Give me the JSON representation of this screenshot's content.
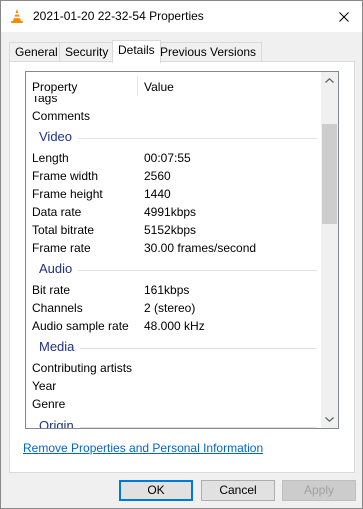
{
  "window": {
    "title": "2021-01-20 22-32-54 Properties"
  },
  "colors": {
    "group_header": "#1e3287",
    "link": "#0066cc",
    "accent": "#0078d7"
  },
  "tabs": [
    {
      "label": "General",
      "active": false
    },
    {
      "label": "Security",
      "active": false
    },
    {
      "label": "Details",
      "active": true
    },
    {
      "label": "Previous Versions",
      "active": false
    }
  ],
  "columns": {
    "property": "Property",
    "value": "Value"
  },
  "rows": {
    "tags": {
      "prop": "Tags",
      "val": ""
    },
    "comments": {
      "prop": "Comments",
      "val": ""
    },
    "video_group": "Video",
    "length": {
      "prop": "Length",
      "val": "00:07:55"
    },
    "frame_width": {
      "prop": "Frame width",
      "val": "2560"
    },
    "frame_height": {
      "prop": "Frame height",
      "val": "1440"
    },
    "data_rate": {
      "prop": "Data rate",
      "val": "4991kbps"
    },
    "total_bitrate": {
      "prop": "Total bitrate",
      "val": "5152kbps"
    },
    "frame_rate": {
      "prop": "Frame rate",
      "val": "30.00 frames/second"
    },
    "audio_group": "Audio",
    "bit_rate": {
      "prop": "Bit rate",
      "val": "161kbps"
    },
    "channels": {
      "prop": "Channels",
      "val": "2 (stereo)"
    },
    "audio_sample_rate": {
      "prop": "Audio sample rate",
      "val": "48.000 kHz"
    },
    "media_group": "Media",
    "contributing_artists": {
      "prop": "Contributing artists",
      "val": ""
    },
    "year": {
      "prop": "Year",
      "val": ""
    },
    "genre": {
      "prop": "Genre",
      "val": ""
    },
    "origin_group": "Origin"
  },
  "link": {
    "label": "Remove Properties and Personal Information"
  },
  "buttons": {
    "ok": "OK",
    "cancel": "Cancel",
    "apply": "Apply"
  }
}
